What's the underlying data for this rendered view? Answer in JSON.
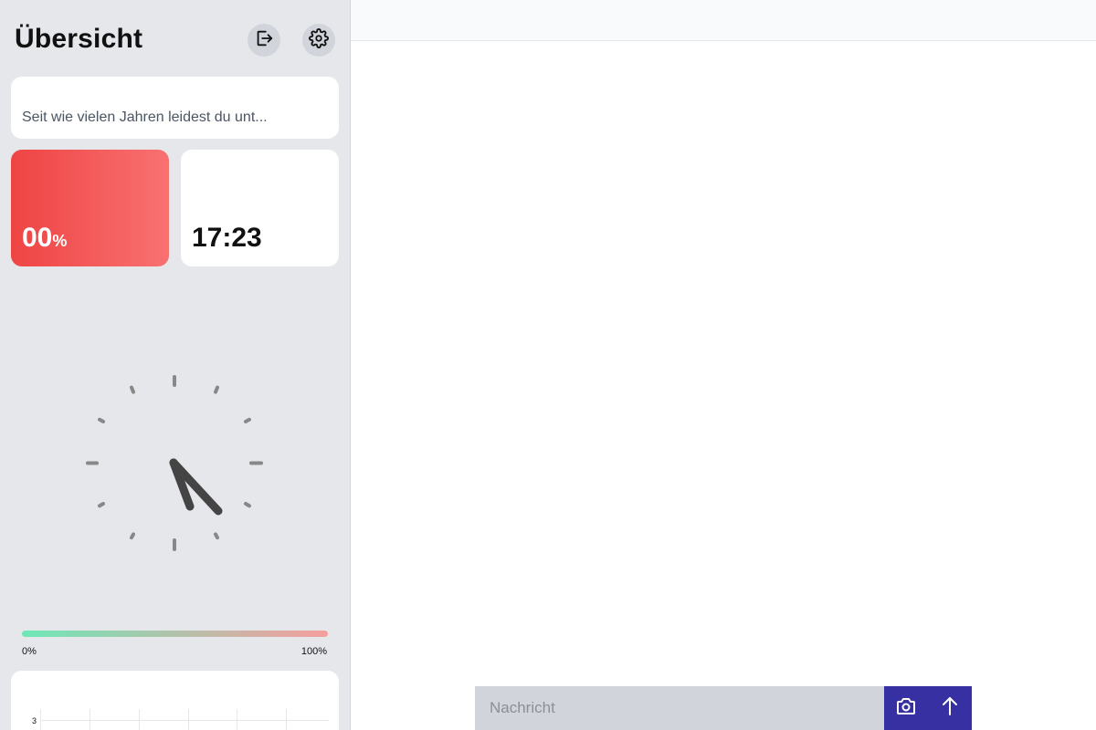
{
  "sidebar": {
    "title": "Übersicht",
    "icons": {
      "logout": "logout-icon",
      "settings": "gear-icon"
    },
    "question": {
      "text": "Seit wie vielen Jahren leidest du unt..."
    },
    "percent_card": {
      "value": "00",
      "unit": "%",
      "gradient": [
        "#ef4444",
        "#f87171"
      ]
    },
    "time_card": {
      "value": "17:23"
    },
    "scale": {
      "min_label": "0%",
      "max_label": "100%",
      "gradient": [
        "#6ee7b7",
        "#f59e9e"
      ]
    },
    "mini_chart": {
      "y_tick": "3"
    }
  },
  "chart_data": {
    "type": "line",
    "y_ticks": [
      "3"
    ],
    "title": "",
    "xlabel": "",
    "ylabel": ""
  },
  "composer": {
    "placeholder": "Nachricht",
    "camera_icon": "camera-icon",
    "send_icon": "arrow-up-icon",
    "accent": "#3730a3"
  }
}
